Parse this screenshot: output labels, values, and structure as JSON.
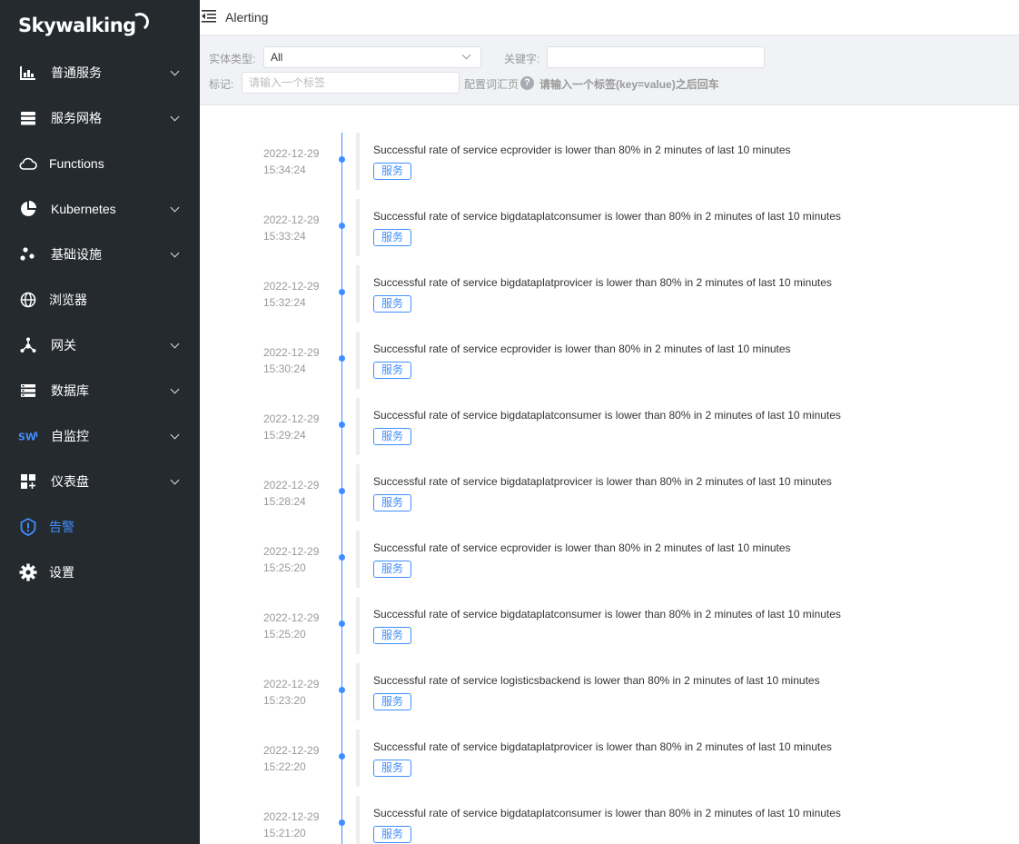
{
  "app": {
    "logo": "Skywalking"
  },
  "sidebar": {
    "items": [
      {
        "label": "普通服务",
        "icon": "bar-chart-icon",
        "expandable": true
      },
      {
        "label": "服务网格",
        "icon": "stack-icon",
        "expandable": true
      },
      {
        "label": "Functions",
        "icon": "cloud-icon",
        "expandable": false
      },
      {
        "label": "Kubernetes",
        "icon": "pie-chart-icon",
        "expandable": true
      },
      {
        "label": "基础设施",
        "icon": "nodes-icon",
        "expandable": true
      },
      {
        "label": "浏览器",
        "icon": "globe-icon",
        "expandable": false
      },
      {
        "label": "网关",
        "icon": "gateway-icon",
        "expandable": true
      },
      {
        "label": "数据库",
        "icon": "database-icon",
        "expandable": true
      },
      {
        "label": "自监控",
        "icon": "sw-logo-icon",
        "expandable": true
      },
      {
        "label": "仪表盘",
        "icon": "dashboard-add-icon",
        "expandable": true
      },
      {
        "label": "告警",
        "icon": "alert-shield-icon",
        "expandable": false,
        "active": true
      },
      {
        "label": "设置",
        "icon": "gear-icon",
        "expandable": false
      }
    ],
    "active_color": "#3f8eff"
  },
  "header": {
    "title": "Alerting"
  },
  "filters": {
    "entity_type_label": "实体类型:",
    "entity_type_value": "All",
    "keyword_label": "关键字:",
    "keyword_value": "",
    "tag_label": "标记:",
    "tag_placeholder": "请输入一个标签",
    "vocab_label": "配置词汇页",
    "help_glyph": "?",
    "hint": "请输入一个标签(key=value)之后回车"
  },
  "alerts": [
    {
      "date": "2022-12-29",
      "time": "15:34:24",
      "message": "Successful rate of service ecprovider is lower than 80% in 2 minutes of last 10 minutes",
      "tag": "服务"
    },
    {
      "date": "2022-12-29",
      "time": "15:33:24",
      "message": "Successful rate of service bigdataplatconsumer is lower than 80% in 2 minutes of last 10 minutes",
      "tag": "服务"
    },
    {
      "date": "2022-12-29",
      "time": "15:32:24",
      "message": "Successful rate of service bigdataplatprovicer is lower than 80% in 2 minutes of last 10 minutes",
      "tag": "服务"
    },
    {
      "date": "2022-12-29",
      "time": "15:30:24",
      "message": "Successful rate of service ecprovider is lower than 80% in 2 minutes of last 10 minutes",
      "tag": "服务"
    },
    {
      "date": "2022-12-29",
      "time": "15:29:24",
      "message": "Successful rate of service bigdataplatconsumer is lower than 80% in 2 minutes of last 10 minutes",
      "tag": "服务"
    },
    {
      "date": "2022-12-29",
      "time": "15:28:24",
      "message": "Successful rate of service bigdataplatprovicer is lower than 80% in 2 minutes of last 10 minutes",
      "tag": "服务"
    },
    {
      "date": "2022-12-29",
      "time": "15:25:20",
      "message": "Successful rate of service ecprovider is lower than 80% in 2 minutes of last 10 minutes",
      "tag": "服务"
    },
    {
      "date": "2022-12-29",
      "time": "15:25:20",
      "message": "Successful rate of service bigdataplatconsumer is lower than 80% in 2 minutes of last 10 minutes",
      "tag": "服务"
    },
    {
      "date": "2022-12-29",
      "time": "15:23:20",
      "message": "Successful rate of service logisticsbackend is lower than 80% in 2 minutes of last 10 minutes",
      "tag": "服务"
    },
    {
      "date": "2022-12-29",
      "time": "15:22:20",
      "message": "Successful rate of service bigdataplatprovicer is lower than 80% in 2 minutes of last 10 minutes",
      "tag": "服务"
    },
    {
      "date": "2022-12-29",
      "time": "15:21:20",
      "message": "Successful rate of service bigdataplatconsumer is lower than 80% in 2 minutes of last 10 minutes",
      "tag": "服务"
    }
  ]
}
